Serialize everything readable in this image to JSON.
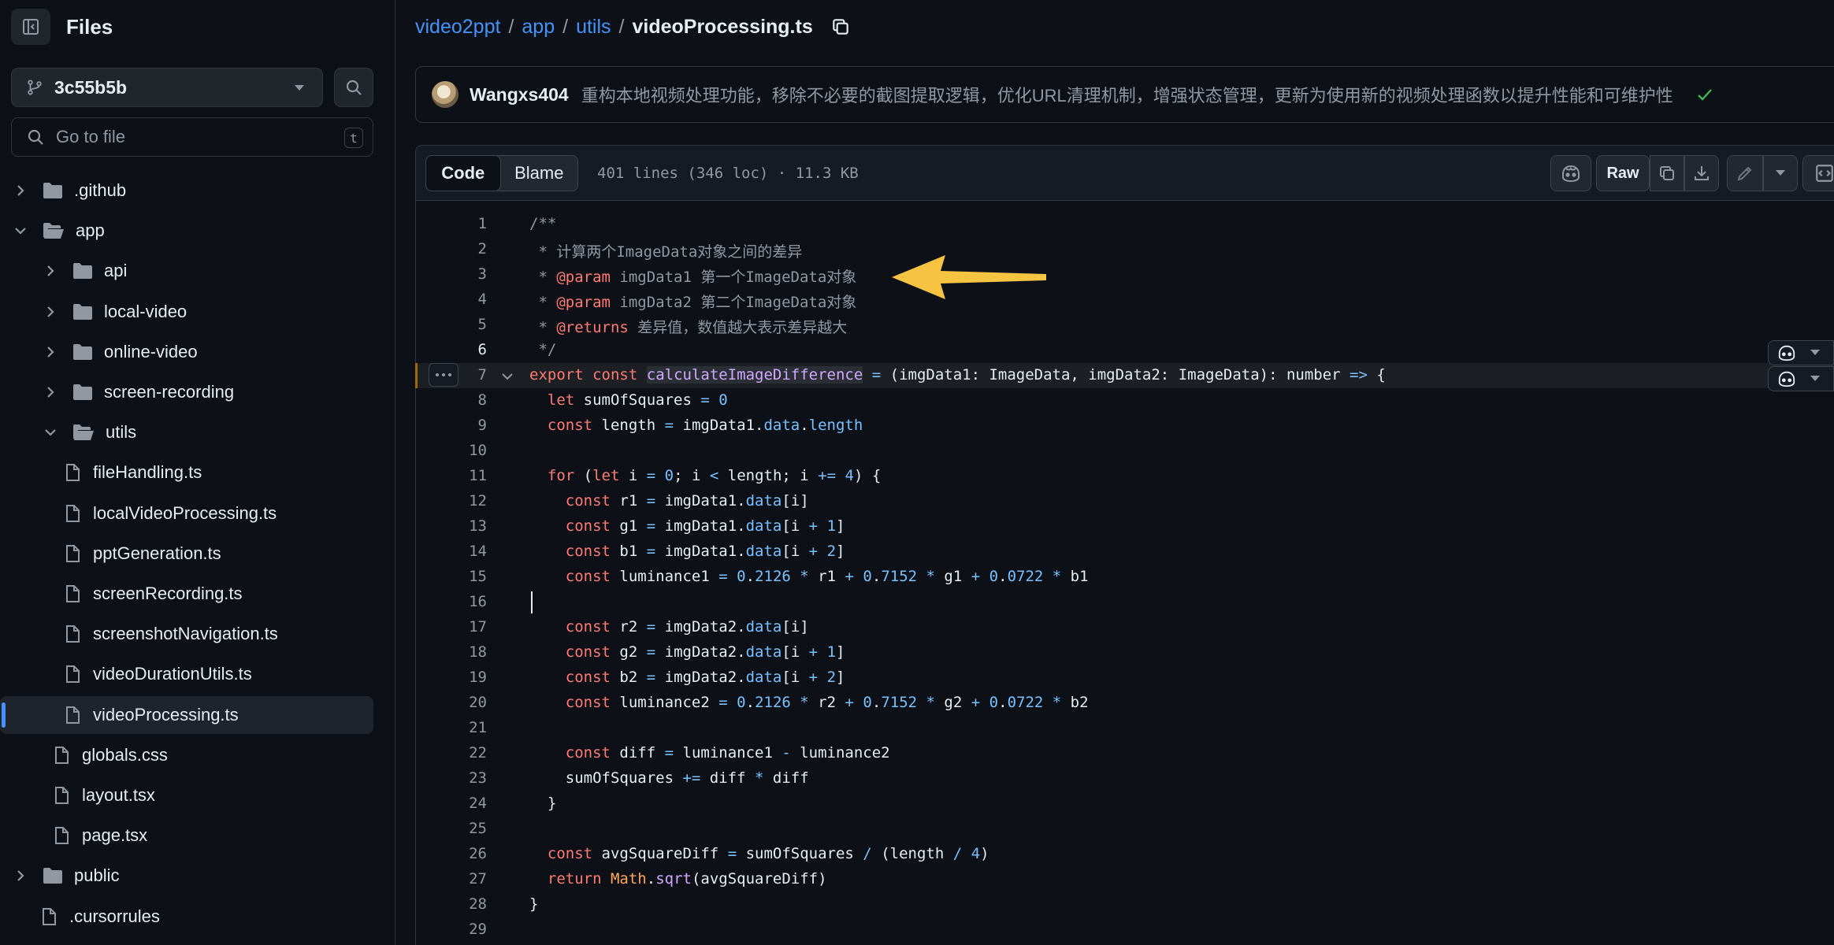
{
  "sidebar": {
    "title": "Files",
    "branch": "3c55b5b",
    "goto_placeholder": "Go to file",
    "goto_shortcut": "t",
    "tree": [
      {
        "label": ".github",
        "type": "folder",
        "depth": 0,
        "expanded": false
      },
      {
        "label": "app",
        "type": "folder",
        "depth": 0,
        "expanded": true
      },
      {
        "label": "api",
        "type": "folder",
        "depth": 1,
        "expanded": false
      },
      {
        "label": "local-video",
        "type": "folder",
        "depth": 1,
        "expanded": false
      },
      {
        "label": "online-video",
        "type": "folder",
        "depth": 1,
        "expanded": false
      },
      {
        "label": "screen-recording",
        "type": "folder",
        "depth": 1,
        "expanded": false
      },
      {
        "label": "utils",
        "type": "folder",
        "depth": 1,
        "expanded": true
      },
      {
        "label": "fileHandling.ts",
        "type": "file",
        "depth": 2
      },
      {
        "label": "localVideoProcessing.ts",
        "type": "file",
        "depth": 2
      },
      {
        "label": "pptGeneration.ts",
        "type": "file",
        "depth": 2
      },
      {
        "label": "screenRecording.ts",
        "type": "file",
        "depth": 2
      },
      {
        "label": "screenshotNavigation.ts",
        "type": "file",
        "depth": 2
      },
      {
        "label": "videoDurationUtils.ts",
        "type": "file",
        "depth": 2
      },
      {
        "label": "videoProcessing.ts",
        "type": "file",
        "depth": 2,
        "selected": true
      },
      {
        "label": "globals.css",
        "type": "file",
        "depth": 1
      },
      {
        "label": "layout.tsx",
        "type": "file",
        "depth": 1
      },
      {
        "label": "page.tsx",
        "type": "file",
        "depth": 1
      },
      {
        "label": "public",
        "type": "folder",
        "depth": 0,
        "expanded": false
      },
      {
        "label": ".cursorrules",
        "type": "file",
        "depth": 0
      }
    ]
  },
  "breadcrumb": {
    "repo": "video2ppt",
    "p1": "app",
    "p2": "utils",
    "file": "videoProcessing.ts",
    "sep": "/"
  },
  "commit": {
    "author": "Wangxs404",
    "message": "重构本地视频处理功能，移除不必要的截图提取逻辑，优化URL清理机制，增强状态管理，更新为使用新的视频处理函数以提升性能和可维护性"
  },
  "toolbar": {
    "code_tab": "Code",
    "blame_tab": "Blame",
    "file_info": "401 lines (346 loc) · 11.3 KB",
    "raw_label": "Raw"
  },
  "code": {
    "current_line": 6,
    "highlighted_line": 7,
    "lines": [
      {
        "n": "1",
        "t": "/**"
      },
      {
        "n": "2",
        "t": " * 计算两个ImageData对象之间的差异"
      },
      {
        "n": "3",
        "t": " * @param imgData1 第一个ImageData对象"
      },
      {
        "n": "4",
        "t": " * @param imgData2 第二个ImageData对象"
      },
      {
        "n": "5",
        "t": " * @returns 差异值，数值越大表示差异越大"
      },
      {
        "n": "6",
        "t": " */"
      },
      {
        "n": "7",
        "t": "export const calculateImageDifference = (imgData1: ImageData, imgData2: ImageData): number => {"
      },
      {
        "n": "8",
        "t": "  let sumOfSquares = 0"
      },
      {
        "n": "9",
        "t": "  const length = imgData1.data.length"
      },
      {
        "n": "10",
        "t": ""
      },
      {
        "n": "11",
        "t": "  for (let i = 0; i < length; i += 4) {"
      },
      {
        "n": "12",
        "t": "    const r1 = imgData1.data[i]"
      },
      {
        "n": "13",
        "t": "    const g1 = imgData1.data[i + 1]"
      },
      {
        "n": "14",
        "t": "    const b1 = imgData1.data[i + 2]"
      },
      {
        "n": "15",
        "t": "    const luminance1 = 0.2126 * r1 + 0.7152 * g1 + 0.0722 * b1"
      },
      {
        "n": "16",
        "t": ""
      },
      {
        "n": "17",
        "t": "    const r2 = imgData2.data[i]"
      },
      {
        "n": "18",
        "t": "    const g2 = imgData2.data[i + 1]"
      },
      {
        "n": "19",
        "t": "    const b2 = imgData2.data[i + 2]"
      },
      {
        "n": "20",
        "t": "    const luminance2 = 0.2126 * r2 + 0.7152 * g2 + 0.0722 * b2"
      },
      {
        "n": "21",
        "t": ""
      },
      {
        "n": "22",
        "t": "    const diff = luminance1 - luminance2"
      },
      {
        "n": "23",
        "t": "    sumOfSquares += diff * diff"
      },
      {
        "n": "24",
        "t": "  }"
      },
      {
        "n": "25",
        "t": ""
      },
      {
        "n": "26",
        "t": "  const avgSquareDiff = sumOfSquares / (length / 4)"
      },
      {
        "n": "27",
        "t": "  return Math.sqrt(avgSquareDiff)"
      },
      {
        "n": "28",
        "t": "}"
      },
      {
        "n": "29",
        "t": ""
      }
    ]
  },
  "colors": {
    "accent": "#4493f8",
    "success": "#3fb950",
    "annotation_arrow": "#f6c343"
  }
}
